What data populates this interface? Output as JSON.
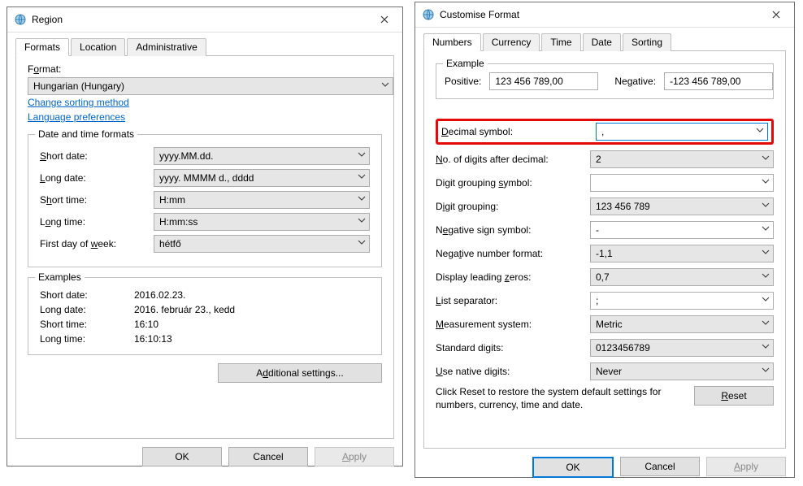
{
  "region": {
    "title": "Region",
    "close_glyph": "×",
    "tabs": {
      "formats": "Formats",
      "location": "Location",
      "administrative": "Administrative"
    },
    "format_label_html": "F<u>o</u>rmat:",
    "format_value": "Hungarian (Hungary)",
    "links": {
      "sorting": "Change sorting method",
      "lang": "Language preferences"
    },
    "dt_group_label": "Date and time formats",
    "dt": {
      "short_date_label_html": "<u>S</u>hort date:",
      "short_date_value": "yyyy.MM.dd.",
      "long_date_label_html": "<u>L</u>ong date:",
      "long_date_value": "yyyy. MMMM d., dddd",
      "short_time_label_html": "S<u>h</u>ort time:",
      "short_time_value": "H:mm",
      "long_time_label_html": "L<u>o</u>ng time:",
      "long_time_value": "H:mm:ss",
      "fdow_label_html": "First day of <u>w</u>eek:",
      "fdow_value": "hétfő"
    },
    "examples_label": "Examples",
    "examples": {
      "short_date_k": "Short date:",
      "short_date_v": "2016.02.23.",
      "long_date_k": "Long date:",
      "long_date_v": "2016. február 23., kedd",
      "short_time_k": "Short time:",
      "short_time_v": "16:10",
      "long_time_k": "Long time:",
      "long_time_v": "16:10:13"
    },
    "additional_btn_html": "A<u>d</u>ditional settings...",
    "ok_label": "OK",
    "cancel_label": "Cancel",
    "apply_label_html": "<u>A</u>pply"
  },
  "custom": {
    "title": "Customise Format",
    "close_glyph": "×",
    "tabs": {
      "numbers": "Numbers",
      "currency": "Currency",
      "time": "Time",
      "date": "Date",
      "sorting": "Sorting"
    },
    "example_label": "Example",
    "positive_label": "Positive:",
    "positive_value": "123 456 789,00",
    "negative_label": "Negative:",
    "negative_value": "-123 456 789,00",
    "fields": {
      "decimal_label_html": "<u>D</u>ecimal symbol:",
      "decimal_value": ",",
      "ndad_label_html": "<u>N</u>o. of digits after decimal:",
      "ndad_value": "2",
      "dgs_label_html": "Digit grouping <u>s</u>ymbol:",
      "dgs_value": "",
      "dg_label_html": "D<u>i</u>git grouping:",
      "dg_value": "123 456 789",
      "neg_sign_label_html": "N<u>e</u>gative sign symbol:",
      "neg_sign_value": "-",
      "neg_fmt_label_html": "Nega<u>t</u>ive number format:",
      "neg_fmt_value": "-1,1",
      "lead_zero_label_html": "Display leading <u>z</u>eros:",
      "lead_zero_value": "0,7",
      "list_sep_label_html": "<u>L</u>ist separator:",
      "list_sep_value": ";",
      "meas_label_html": "<u>M</u>easurement system:",
      "meas_value": "Metric",
      "std_digits_label_html": "Standard di<u>g</u>its:",
      "std_digits_value": "0123456789",
      "native_label_html": "<u>U</u>se native digits:",
      "native_value": "Never"
    },
    "reset_text": "Click Reset to restore the system default settings for numbers, currency, time and date.",
    "reset_btn_html": "<u>R</u>eset",
    "ok_label": "OK",
    "cancel_label": "Cancel",
    "apply_label_html": "<u>A</u>pply"
  }
}
